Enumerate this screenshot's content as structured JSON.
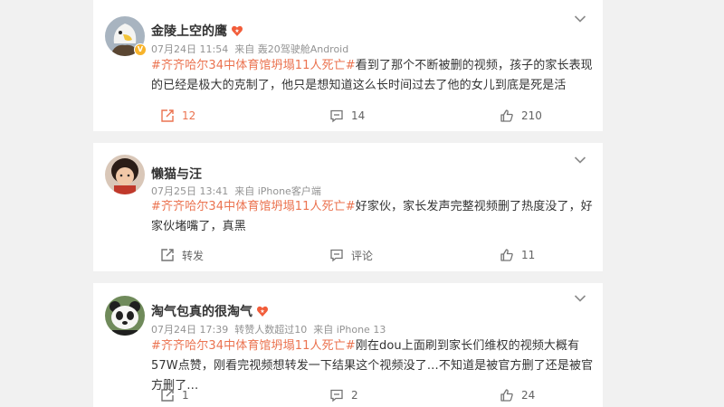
{
  "posts": [
    {
      "username": "金陵上空的鹰",
      "time": "07月24日 11:54",
      "source": "来自 轰20驾驶舱Android",
      "hashtag": "#齐齐哈尔34中体育馆坍塌11人死亡#",
      "text": "看到了那个不断被删的视频，孩子的家长表现的已经是极大的克制了，他只是想知道这么长时间过去了他的女儿到底是死是活",
      "repost_label": "12",
      "comment_label": "14",
      "like_label": "210",
      "accent": "#eb7350"
    },
    {
      "username": "懒猫与汪",
      "time": "07月25日 13:41",
      "source": "来自 iPhone客户端",
      "hashtag": "#齐齐哈尔34中体育馆坍塌11人死亡#",
      "text": "好家伙，家长发声完整视频删了热度没了，好家伙堵嘴了，真黑",
      "repost_label": "转发",
      "comment_label": "评论",
      "like_label": "11"
    },
    {
      "username": "淘气包真的很淘气",
      "time": "07月24日 17:39",
      "extra": "转赞人数超过10",
      "source": "来自 iPhone 13",
      "hashtag": "#齐齐哈尔34中体育馆坍塌11人死亡#",
      "text": "刚在dou上面刷到家长们维权的视频大概有57W点赞，刚看完视频想转发一下结果这个视频没了…不知道是被官方删了还是被官方删了…",
      "repost_label": "1",
      "comment_label": "2",
      "like_label": "24"
    }
  ],
  "icons": {
    "repost": "repost-icon",
    "comment": "comment-icon",
    "like": "like-icon",
    "menu": "chevron-down-icon",
    "verified": "verified-icon",
    "level": "fan-level-icon"
  },
  "colors": {
    "background": "#f1f1f1",
    "card": "#ffffff",
    "hashtag": "#eb7350",
    "meta": "#939393",
    "verified_badge": "#f7b32b"
  }
}
